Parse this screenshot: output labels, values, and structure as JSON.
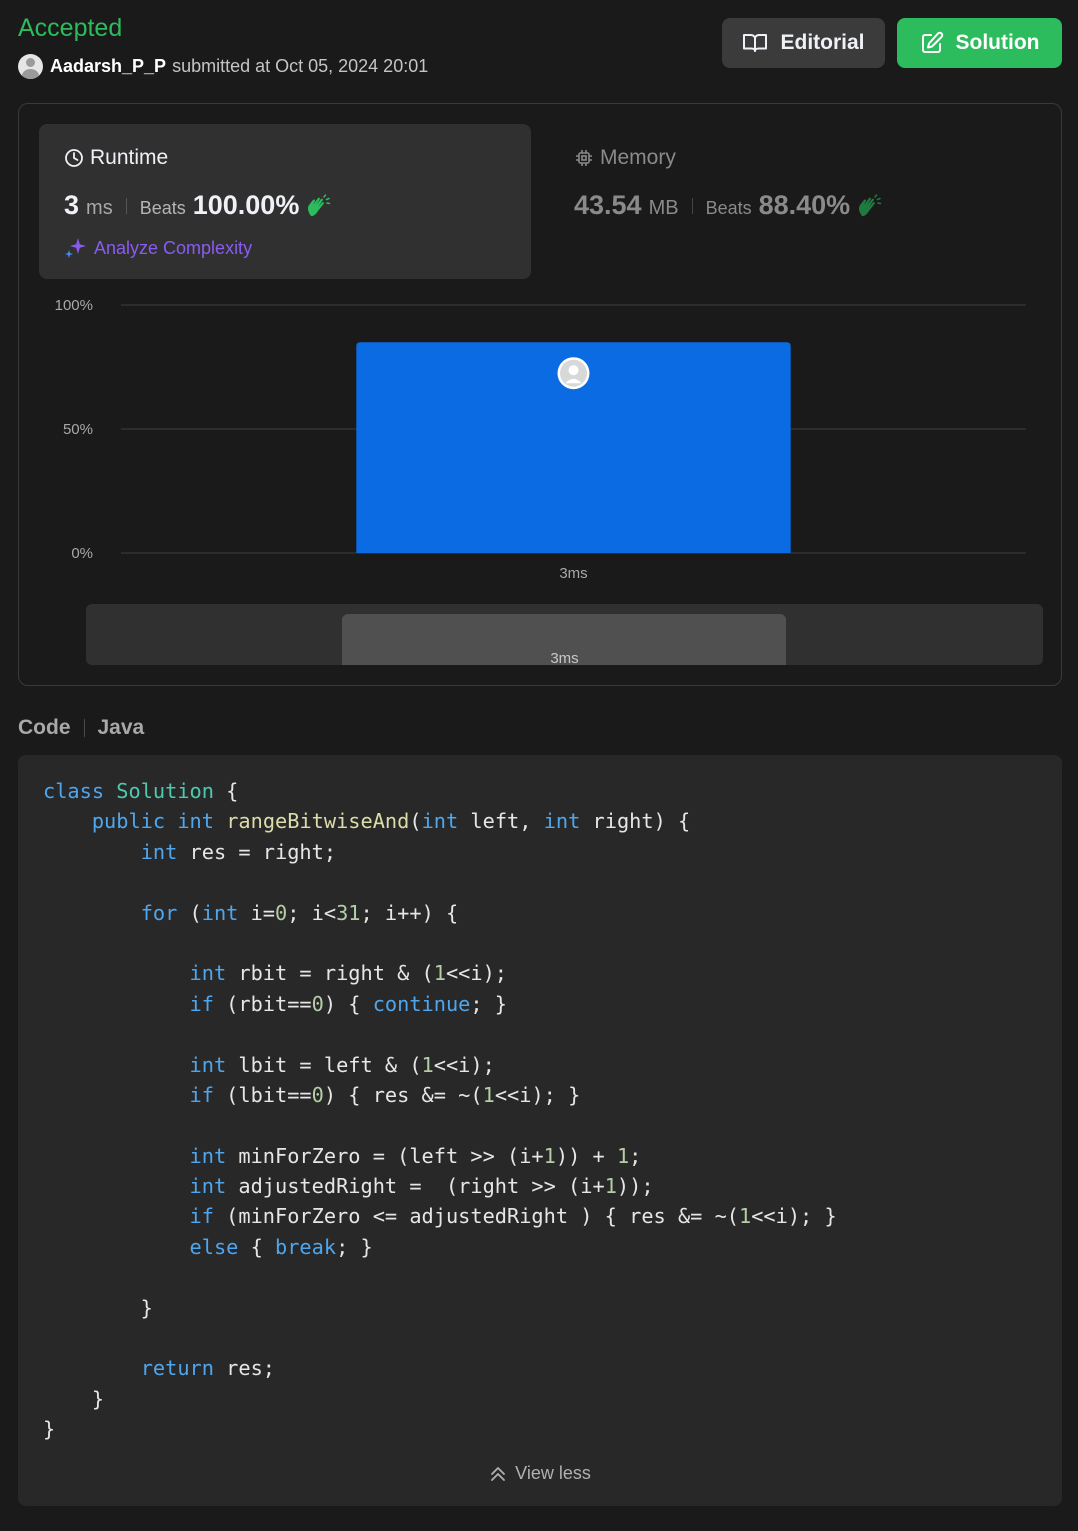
{
  "header": {
    "status": "Accepted",
    "username": "Aadarsh_P_P",
    "submitted_text": "submitted at Oct 05, 2024 20:01",
    "editorial_label": "Editorial",
    "solution_label": "Solution"
  },
  "runtime": {
    "title": "Runtime",
    "value": "3",
    "unit": "ms",
    "beats_label": "Beats",
    "beats_pct": "100.00%",
    "analyze_label": "Analyze Complexity"
  },
  "memory": {
    "title": "Memory",
    "value": "43.54",
    "unit": "MB",
    "beats_label": "Beats",
    "beats_pct": "88.40%"
  },
  "chart_data": {
    "type": "bar",
    "categories": [
      "3ms"
    ],
    "values": [
      85
    ],
    "ylim": [
      0,
      100
    ],
    "yticks": [
      "0%",
      "50%",
      "100%"
    ],
    "grid": true
  },
  "mini_chart": {
    "label": "3ms"
  },
  "code_section": {
    "label": "Code",
    "language": "Java",
    "view_less": "View less"
  },
  "colors": {
    "accent_green": "#2cbb5d",
    "bar_blue": "#0a6be3",
    "analyze_purple": "#8a5bf0"
  },
  "code_lines": [
    [
      [
        "kw",
        "class"
      ],
      [
        "t",
        " "
      ],
      [
        "cls",
        "Solution"
      ],
      [
        "t",
        " {"
      ]
    ],
    [
      [
        "t",
        "    "
      ],
      [
        "kw",
        "public"
      ],
      [
        "t",
        " "
      ],
      [
        "kw",
        "int"
      ],
      [
        "t",
        " "
      ],
      [
        "fn",
        "rangeBitwiseAnd"
      ],
      [
        "t",
        "("
      ],
      [
        "kw",
        "int"
      ],
      [
        "t",
        " left, "
      ],
      [
        "kw",
        "int"
      ],
      [
        "t",
        " right) {"
      ]
    ],
    [
      [
        "t",
        "        "
      ],
      [
        "kw",
        "int"
      ],
      [
        "t",
        " res = right;"
      ]
    ],
    [
      [
        "t",
        ""
      ]
    ],
    [
      [
        "t",
        "        "
      ],
      [
        "kw",
        "for"
      ],
      [
        "t",
        " ("
      ],
      [
        "kw",
        "int"
      ],
      [
        "t",
        " i="
      ],
      [
        "num",
        "0"
      ],
      [
        "t",
        "; i<"
      ],
      [
        "num",
        "31"
      ],
      [
        "t",
        "; i++) {"
      ]
    ],
    [
      [
        "t",
        ""
      ]
    ],
    [
      [
        "t",
        "            "
      ],
      [
        "kw",
        "int"
      ],
      [
        "t",
        " rbit = right & ("
      ],
      [
        "num",
        "1"
      ],
      [
        "t",
        "<<i);"
      ]
    ],
    [
      [
        "t",
        "            "
      ],
      [
        "kw",
        "if"
      ],
      [
        "t",
        " (rbit=="
      ],
      [
        "num",
        "0"
      ],
      [
        "t",
        ") { "
      ],
      [
        "kw",
        "continue"
      ],
      [
        "t",
        "; }"
      ]
    ],
    [
      [
        "t",
        ""
      ]
    ],
    [
      [
        "t",
        "            "
      ],
      [
        "kw",
        "int"
      ],
      [
        "t",
        " lbit = left & ("
      ],
      [
        "num",
        "1"
      ],
      [
        "t",
        "<<i);"
      ]
    ],
    [
      [
        "t",
        "            "
      ],
      [
        "kw",
        "if"
      ],
      [
        "t",
        " (lbit=="
      ],
      [
        "num",
        "0"
      ],
      [
        "t",
        ") { res &= ~("
      ],
      [
        "num",
        "1"
      ],
      [
        "t",
        "<<i); }"
      ]
    ],
    [
      [
        "t",
        ""
      ]
    ],
    [
      [
        "t",
        "            "
      ],
      [
        "kw",
        "int"
      ],
      [
        "t",
        " minForZero = (left >> (i+"
      ],
      [
        "num",
        "1"
      ],
      [
        "t",
        ")) + "
      ],
      [
        "num",
        "1"
      ],
      [
        "t",
        ";"
      ]
    ],
    [
      [
        "t",
        "            "
      ],
      [
        "kw",
        "int"
      ],
      [
        "t",
        " adjustedRight =  (right >> (i+"
      ],
      [
        "num",
        "1"
      ],
      [
        "t",
        "));"
      ]
    ],
    [
      [
        "t",
        "            "
      ],
      [
        "kw",
        "if"
      ],
      [
        "t",
        " (minForZero <= adjustedRight ) { res &= ~("
      ],
      [
        "num",
        "1"
      ],
      [
        "t",
        "<<i); }"
      ]
    ],
    [
      [
        "t",
        "            "
      ],
      [
        "kw",
        "else"
      ],
      [
        "t",
        " { "
      ],
      [
        "kw",
        "break"
      ],
      [
        "t",
        "; }"
      ]
    ],
    [
      [
        "t",
        ""
      ]
    ],
    [
      [
        "t",
        "        }"
      ]
    ],
    [
      [
        "t",
        ""
      ]
    ],
    [
      [
        "t",
        "        "
      ],
      [
        "kw",
        "return"
      ],
      [
        "t",
        " res;"
      ]
    ],
    [
      [
        "t",
        "    }"
      ]
    ],
    [
      [
        "t",
        "}"
      ]
    ]
  ]
}
